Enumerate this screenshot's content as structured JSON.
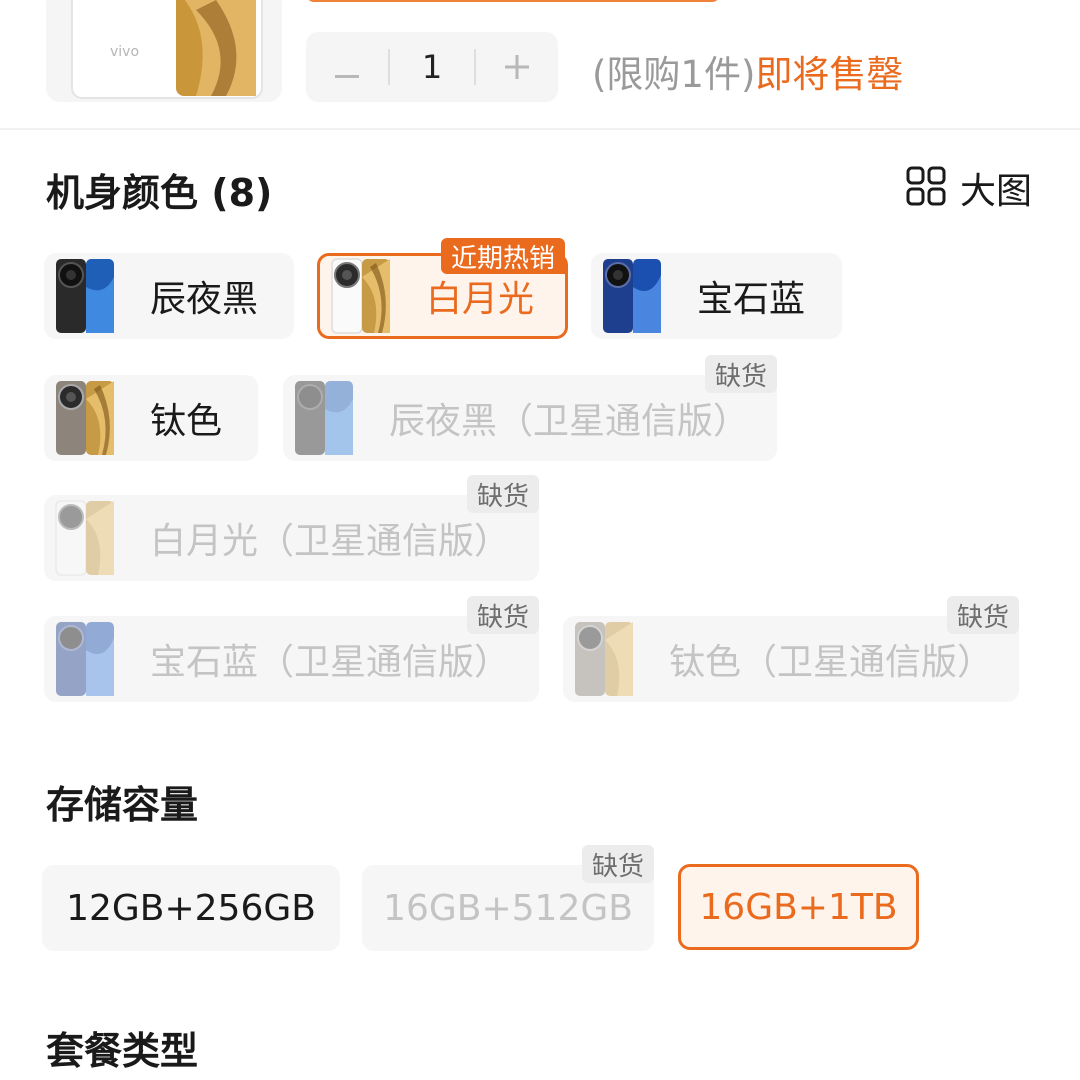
{
  "product": {
    "thumb_brand": "vivo",
    "quantity": "1",
    "decrement_label": "−",
    "increment_label": "+",
    "limit_text": "(限购1件)",
    "stock_warning": "即将售罄"
  },
  "color_section": {
    "title": "机身颜色 (8)",
    "big_view_label": "大图",
    "options": [
      {
        "label": "辰夜黑",
        "selected": false,
        "available": true
      },
      {
        "label": "白月光",
        "selected": true,
        "available": true,
        "badge": "近期热销"
      },
      {
        "label": "宝石蓝",
        "selected": false,
        "available": true
      },
      {
        "label": "钛色",
        "selected": false,
        "available": true
      },
      {
        "label": "辰夜黑（卫星通信版）",
        "selected": false,
        "available": false,
        "badge": "缺货"
      },
      {
        "label": "白月光（卫星通信版）",
        "selected": false,
        "available": false,
        "badge": "缺货"
      },
      {
        "label": "宝石蓝（卫星通信版）",
        "selected": false,
        "available": false,
        "badge": "缺货"
      },
      {
        "label": "钛色（卫星通信版）",
        "selected": false,
        "available": false,
        "badge": "缺货"
      }
    ]
  },
  "storage_section": {
    "title": "存储容量",
    "options": [
      {
        "label": "12GB+256GB",
        "selected": false,
        "available": true
      },
      {
        "label": "16GB+512GB",
        "selected": false,
        "available": false,
        "badge": "缺货"
      },
      {
        "label": "16GB+1TB",
        "selected": true,
        "available": true
      }
    ]
  },
  "package_section": {
    "title": "套餐类型"
  },
  "colors": {
    "accent": "#ea6a1e",
    "chip_bg": "#f6f6f6",
    "selected_bg": "#fff4ec",
    "disabled_text": "#c4c4c4"
  },
  "icons": [
    "minus-icon",
    "plus-icon",
    "grid-view-icon"
  ]
}
